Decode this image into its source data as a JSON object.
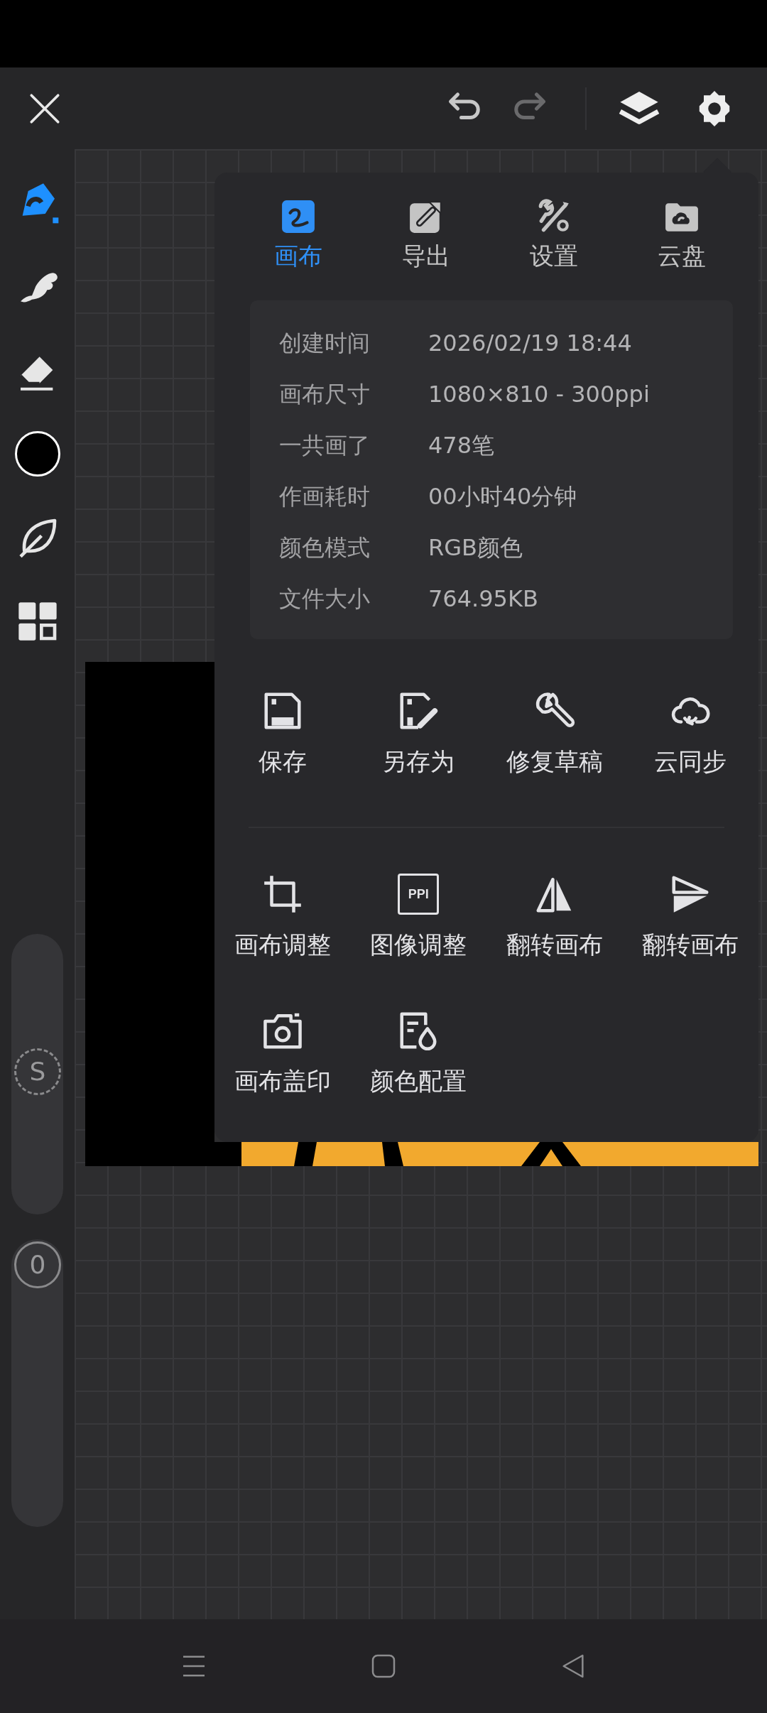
{
  "top_bar": {
    "undo": {
      "disabled": false
    },
    "redo": {
      "disabled": true
    }
  },
  "tools": [
    {
      "kind": "brush",
      "selected": true
    },
    {
      "kind": "smudge",
      "selected": false
    },
    {
      "kind": "eraser",
      "selected": false
    },
    {
      "kind": "color",
      "selected": false,
      "color": "#000000"
    },
    {
      "kind": "leaf",
      "selected": false
    },
    {
      "kind": "grid",
      "selected": false
    }
  ],
  "sliders": [
    {
      "kind": "size",
      "label": "S",
      "level": 0.49
    },
    {
      "kind": "opacity",
      "label": "0"
    }
  ],
  "menu": {
    "tabs": [
      {
        "kind": "canvas",
        "label": "画布",
        "selected": true
      },
      {
        "kind": "export",
        "label": "导出",
        "selected": false
      },
      {
        "kind": "settings",
        "label": "设置",
        "selected": false
      },
      {
        "kind": "cloud",
        "label": "云盘",
        "selected": false
      }
    ],
    "info": [
      {
        "label": "创建时间",
        "value": "2026/02/19 18:44"
      },
      {
        "label": "画布尺寸",
        "value": "1080×810 - 300ppi"
      },
      {
        "label": "一共画了",
        "value": "478笔"
      },
      {
        "label": "作画耗时",
        "value": "00小时40分钟"
      },
      {
        "label": "颜色模式",
        "value": "RGB颜色"
      },
      {
        "label": "文件大小",
        "value": "764.95KB"
      }
    ],
    "action_groups": [
      [
        {
          "kind": "save",
          "label": "保存"
        },
        {
          "kind": "save_as",
          "label": "另存为"
        },
        {
          "kind": "repair",
          "label": "修复草稿"
        },
        {
          "kind": "cloud_sync",
          "label": "云同步"
        }
      ],
      [
        {
          "kind": "crop",
          "label": "画布调整"
        },
        {
          "kind": "ppi",
          "label": "图像调整",
          "icon_text": "PPI"
        },
        {
          "kind": "flip_h",
          "label": "翻转画布"
        },
        {
          "kind": "flip_v",
          "label": "翻转画布"
        },
        {
          "kind": "camera",
          "label": "画布盖印"
        },
        {
          "kind": "color_profile",
          "label": "颜色配置"
        }
      ]
    ]
  }
}
